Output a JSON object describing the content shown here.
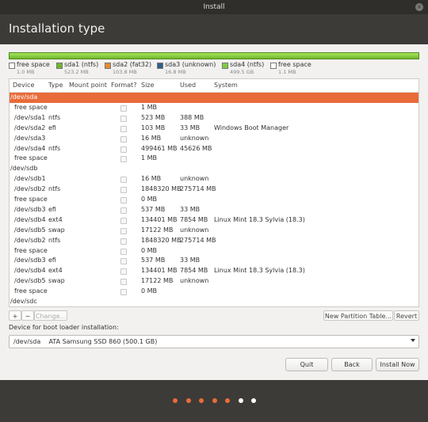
{
  "window": {
    "title": "Install",
    "close_glyph": "×"
  },
  "page": {
    "title": "Installation type"
  },
  "legend": [
    {
      "name": "free space",
      "size": "1.0 MB",
      "color": "#ffffff"
    },
    {
      "name": "sda1 (ntfs)",
      "size": "523.2 MB",
      "color": "#6fb82c"
    },
    {
      "name": "sda2 (fat32)",
      "size": "103.8 MB",
      "color": "#e98a2f"
    },
    {
      "name": "sda3 (unknown)",
      "size": "16.8 MB",
      "color": "#2f5f8a"
    },
    {
      "name": "sda4 (ntfs)",
      "size": "499.5 GB",
      "color": "#7fd03a"
    },
    {
      "name": "free space",
      "size": "1.1 MB",
      "color": "#ffffff"
    }
  ],
  "table": {
    "headers": {
      "device": "Device",
      "type": "Type",
      "mount": "Mount point",
      "format": "Format?",
      "size": "Size",
      "used": "Used",
      "system": "System"
    },
    "rows": [
      {
        "device": "/dev/sda",
        "type": "",
        "size": "",
        "used": "",
        "system": "",
        "checkbox": false,
        "indent": false,
        "selected": true
      },
      {
        "device": "free space",
        "type": "",
        "size": "1 MB",
        "used": "",
        "system": "",
        "checkbox": true,
        "indent": true
      },
      {
        "device": "/dev/sda1",
        "type": "ntfs",
        "size": "523 MB",
        "used": "388 MB",
        "system": "",
        "checkbox": true,
        "indent": true
      },
      {
        "device": "/dev/sda2",
        "type": "efi",
        "size": "103 MB",
        "used": "33 MB",
        "system": "Windows Boot Manager",
        "checkbox": true,
        "indent": true
      },
      {
        "device": "/dev/sda3",
        "type": "",
        "size": "16 MB",
        "used": "unknown",
        "system": "",
        "checkbox": true,
        "indent": true
      },
      {
        "device": "/dev/sda4",
        "type": "ntfs",
        "size": "499461 MB",
        "used": "45626 MB",
        "system": "",
        "checkbox": true,
        "indent": true
      },
      {
        "device": "free space",
        "type": "",
        "size": "1 MB",
        "used": "",
        "system": "",
        "checkbox": true,
        "indent": true
      },
      {
        "device": "/dev/sdb",
        "type": "",
        "size": "",
        "used": "",
        "system": "",
        "checkbox": false,
        "indent": false
      },
      {
        "device": "/dev/sdb1",
        "type": "",
        "size": "16 MB",
        "used": "unknown",
        "system": "",
        "checkbox": true,
        "indent": true
      },
      {
        "device": "/dev/sdb2",
        "type": "ntfs",
        "size": "1848320 MB",
        "used": "275714 MB",
        "system": "",
        "checkbox": true,
        "indent": true
      },
      {
        "device": "free space",
        "type": "",
        "size": "0 MB",
        "used": "",
        "system": "",
        "checkbox": true,
        "indent": true
      },
      {
        "device": "/dev/sdb3",
        "type": "efi",
        "size": "537 MB",
        "used": "33 MB",
        "system": "",
        "checkbox": true,
        "indent": true
      },
      {
        "device": "/dev/sdb4",
        "type": "ext4",
        "size": "134401 MB",
        "used": "7854 MB",
        "system": "Linux Mint 18.3 Sylvia (18.3)",
        "checkbox": true,
        "indent": true
      },
      {
        "device": "/dev/sdb5",
        "type": "swap",
        "size": "17122 MB",
        "used": "unknown",
        "system": "",
        "checkbox": true,
        "indent": true
      },
      {
        "device": "/dev/sdb2",
        "type": "ntfs",
        "size": "1848320 MB",
        "used": "275714 MB",
        "system": "",
        "checkbox": true,
        "indent": true
      },
      {
        "device": "free space",
        "type": "",
        "size": "0 MB",
        "used": "",
        "system": "",
        "checkbox": true,
        "indent": true
      },
      {
        "device": "/dev/sdb3",
        "type": "efi",
        "size": "537 MB",
        "used": "33 MB",
        "system": "",
        "checkbox": true,
        "indent": true
      },
      {
        "device": "/dev/sdb4",
        "type": "ext4",
        "size": "134401 MB",
        "used": "7854 MB",
        "system": "Linux Mint 18.3 Sylvia (18.3)",
        "checkbox": true,
        "indent": true
      },
      {
        "device": "/dev/sdb5",
        "type": "swap",
        "size": "17122 MB",
        "used": "unknown",
        "system": "",
        "checkbox": true,
        "indent": true
      },
      {
        "device": "free space",
        "type": "",
        "size": "0 MB",
        "used": "",
        "system": "",
        "checkbox": true,
        "indent": true
      },
      {
        "device": "/dev/sdc",
        "type": "",
        "size": "",
        "used": "",
        "system": "",
        "checkbox": false,
        "indent": false
      }
    ]
  },
  "toolbar": {
    "add": "+",
    "remove": "−",
    "change": "Change...",
    "new_table": "New Partition Table...",
    "revert": "Revert"
  },
  "bootloader": {
    "label": "Device for boot loader installation:",
    "value": "/dev/sda    ATA Samsung SSD 860 (500.1 GB)"
  },
  "buttons": {
    "quit": "Quit",
    "back": "Back",
    "install": "Install Now"
  },
  "progress": {
    "total_steps": 7,
    "completed_steps": 5,
    "active_color": "#e96b3a",
    "inactive_color": "#ffffff"
  }
}
